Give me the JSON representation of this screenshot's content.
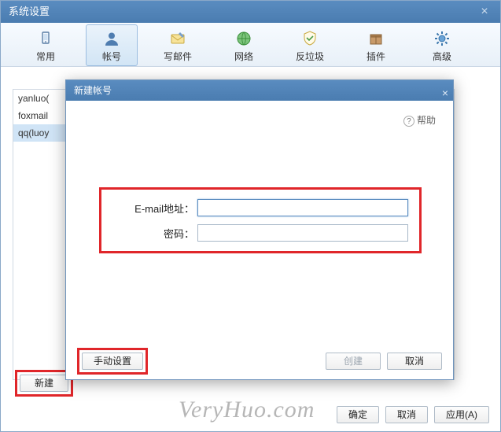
{
  "main": {
    "title": "系统设置",
    "close_glyph": "×"
  },
  "toolbar": {
    "items": [
      {
        "label": "常用"
      },
      {
        "label": "帐号"
      },
      {
        "label": "写邮件"
      },
      {
        "label": "网络"
      },
      {
        "label": "反垃圾"
      },
      {
        "label": "插件"
      },
      {
        "label": "高级"
      }
    ]
  },
  "accounts": {
    "rows": [
      "yanluo(",
      "foxmail",
      "qq(luoy"
    ]
  },
  "buttons": {
    "new": "新建",
    "ok": "确定",
    "cancel": "取消",
    "apply": "应用(A)"
  },
  "dialog": {
    "title": "新建帐号",
    "close_glyph": "×",
    "help": "帮助",
    "email_label": "E-mail地址：",
    "password_label": "密码：",
    "email_value": "",
    "password_value": "",
    "manual": "手动设置",
    "create": "创建",
    "cancel": "取消"
  },
  "watermark": "VeryHuo.com"
}
